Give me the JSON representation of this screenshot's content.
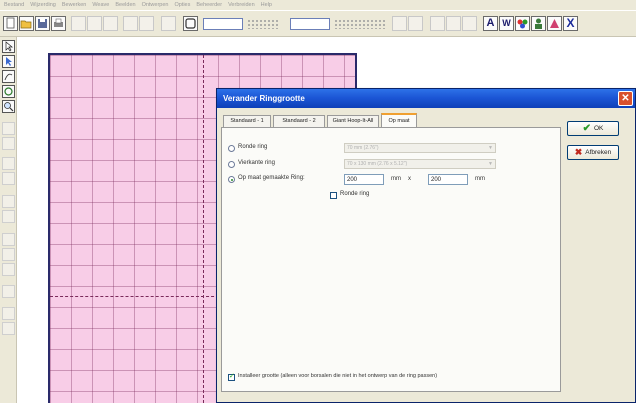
{
  "menu": [
    "Bestand",
    "Wijzerding",
    "Bewerken",
    "Weave",
    "Beelden",
    "Ontwerpen",
    "Opties",
    "Beheerder",
    "Verbreiden",
    "Help"
  ],
  "toolbar": {
    "letter_buttons": [
      "A",
      "W",
      "B",
      "S",
      "X"
    ]
  },
  "dialog": {
    "title": "Verander Ringgrootte",
    "tabs": [
      "Standaard - 1",
      "Standaard - 2",
      "Giant Hoop-It-All",
      "Op maat"
    ],
    "active_tab": "Op maat",
    "options": {
      "round_ring_label": "Ronde ring",
      "round_ring_value": "70 mm (2.76\")",
      "square_ring_label": "Vierkante ring",
      "square_ring_value": "70 x 130 mm (2.76 x 5.12\")",
      "custom_ring_label": "Op maat gemaakte Ring:",
      "width_value": "200",
      "mm_label_1": "mm",
      "times_label": "x",
      "height_value": "200",
      "mm_label_2": "mm",
      "round_ring_checkbox_label": "Ronde ring",
      "install_size_label": "Installeer grootte (alleen voor borsalen die niet in het ontwerp van de ring passen)"
    },
    "ok_label": "OK",
    "cancel_label": "Afbreken"
  },
  "colors": {
    "hoop_fill": "#f8cde7",
    "titlebar": "#1c56d6",
    "accent_tab": "#f0a030"
  }
}
